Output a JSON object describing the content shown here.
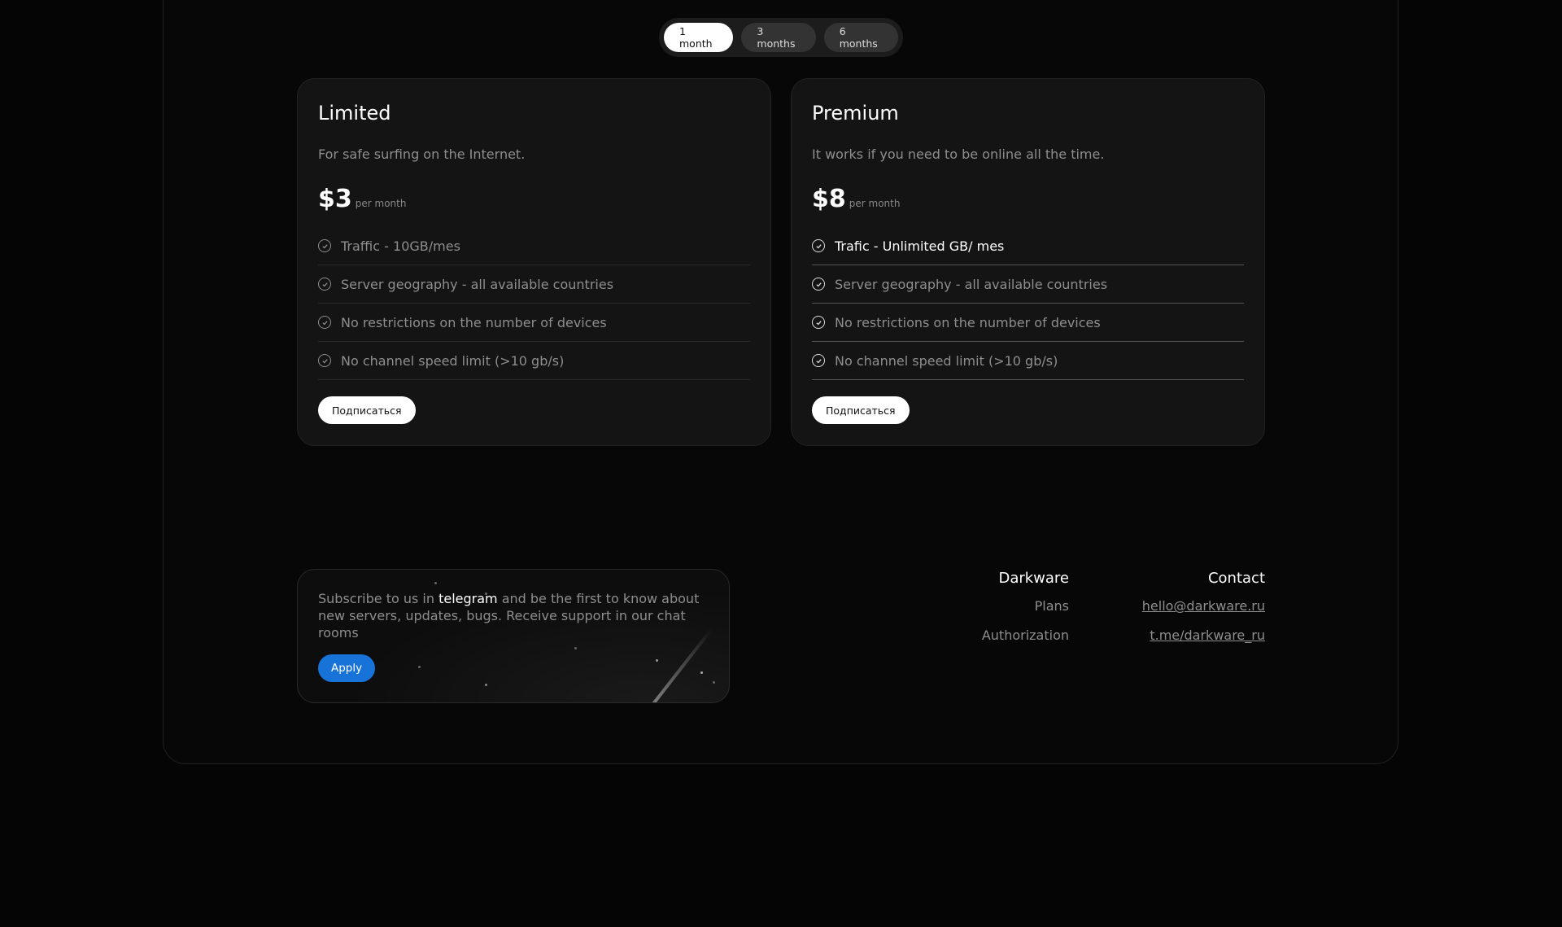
{
  "period_toggle": {
    "options": [
      "1 month",
      "3 months",
      "6 months"
    ],
    "selected": "1 month"
  },
  "plans": [
    {
      "name": "Limited",
      "description": "For safe surfing on the Internet.",
      "price": "$3",
      "period": "per month",
      "features": [
        "Traffic - 10GB/mes",
        "Server geography - all available countries",
        "No restrictions on the number of devices",
        "No channel speed limit (>10 gb/s)"
      ],
      "button_label": "Подписаться"
    },
    {
      "name": "Premium",
      "description": "It works if you need to be online all the time.",
      "price": "$8",
      "period": "per month",
      "features": [
        "Trafic - Unlimited GB/ mes",
        "Server geography - all available countries",
        "No restrictions on the number of devices",
        "No channel speed limit (>10 gb/s)"
      ],
      "button_label": "Подписаться"
    }
  ],
  "telegram_promo": {
    "text_before": "Subscribe to us in ",
    "link_text": "telegram",
    "text_after": " and be the first to know about new servers, updates, bugs. Receive support in our chat rooms",
    "button_label": "Apply"
  },
  "footer": {
    "brand": {
      "title": "Darkware",
      "links": [
        "Plans",
        "Authorization"
      ]
    },
    "contact": {
      "title": "Contact",
      "links": [
        "hello@darkware.ru",
        "t.me/darkware_ru"
      ]
    }
  },
  "colors": {
    "background": "#050505",
    "card": "#141414",
    "accent_button": "#1873d9",
    "muted_text": "#8e8e8e"
  }
}
